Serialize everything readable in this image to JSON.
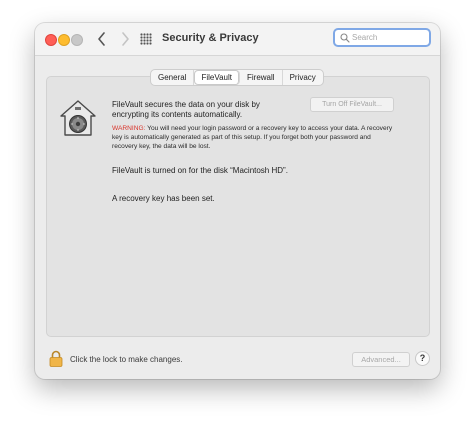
{
  "window": {
    "title": "Security & Privacy",
    "search_placeholder": "Search"
  },
  "tabs": [
    {
      "label": "General",
      "active": false
    },
    {
      "label": "FileVault",
      "active": true
    },
    {
      "label": "Firewall",
      "active": false
    },
    {
      "label": "Privacy",
      "active": false
    }
  ],
  "filevault": {
    "description": "FileVault secures the data on your disk by encrypting its contents automatically.",
    "turn_off_label": "Turn Off FileVault...",
    "warning_label": "WARNING:",
    "warning_text": " You will need your login password or a recovery key to access your data. A recovery key is automatically generated as part of this setup. If you forget both your password and recovery key, the data will be lost.",
    "status": "FileVault is turned on for the disk “Macintosh HD”.",
    "recovery_key": "A recovery key has been set."
  },
  "footer": {
    "lock_text": "Click the lock to make changes.",
    "advanced_label": "Advanced...",
    "help_label": "?"
  },
  "colors": {
    "warning": "#d9342b",
    "search_focus": "#7fa8e6",
    "close": "#ff5f57",
    "minimize": "#febc2e"
  },
  "icons": {
    "house": "filevault-house-safe-icon",
    "lock": "padlock-icon",
    "search": "magnifier-icon",
    "grid": "show-all-grid-icon"
  }
}
